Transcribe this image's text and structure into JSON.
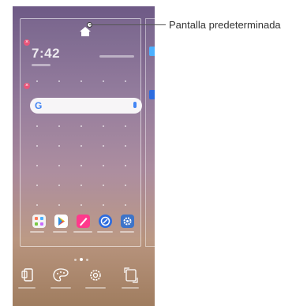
{
  "callout": {
    "label": "Pantalla predeterminada"
  },
  "home_screen": {
    "clock": "7:42",
    "apps": [
      {
        "name": "folder-icon",
        "color": "#f5f5f5"
      },
      {
        "name": "play-store-icon",
        "color": "#ffffff"
      },
      {
        "name": "pen-icon",
        "color": "#ff3a8c"
      },
      {
        "name": "browser-icon",
        "color": "#2d6cdf"
      },
      {
        "name": "settings-icon",
        "color": "#3d74c9"
      }
    ]
  },
  "bottom_buttons": [
    {
      "name": "widgets-button"
    },
    {
      "name": "theme-button"
    },
    {
      "name": "home-settings-button"
    },
    {
      "name": "wallpaper-button"
    }
  ]
}
